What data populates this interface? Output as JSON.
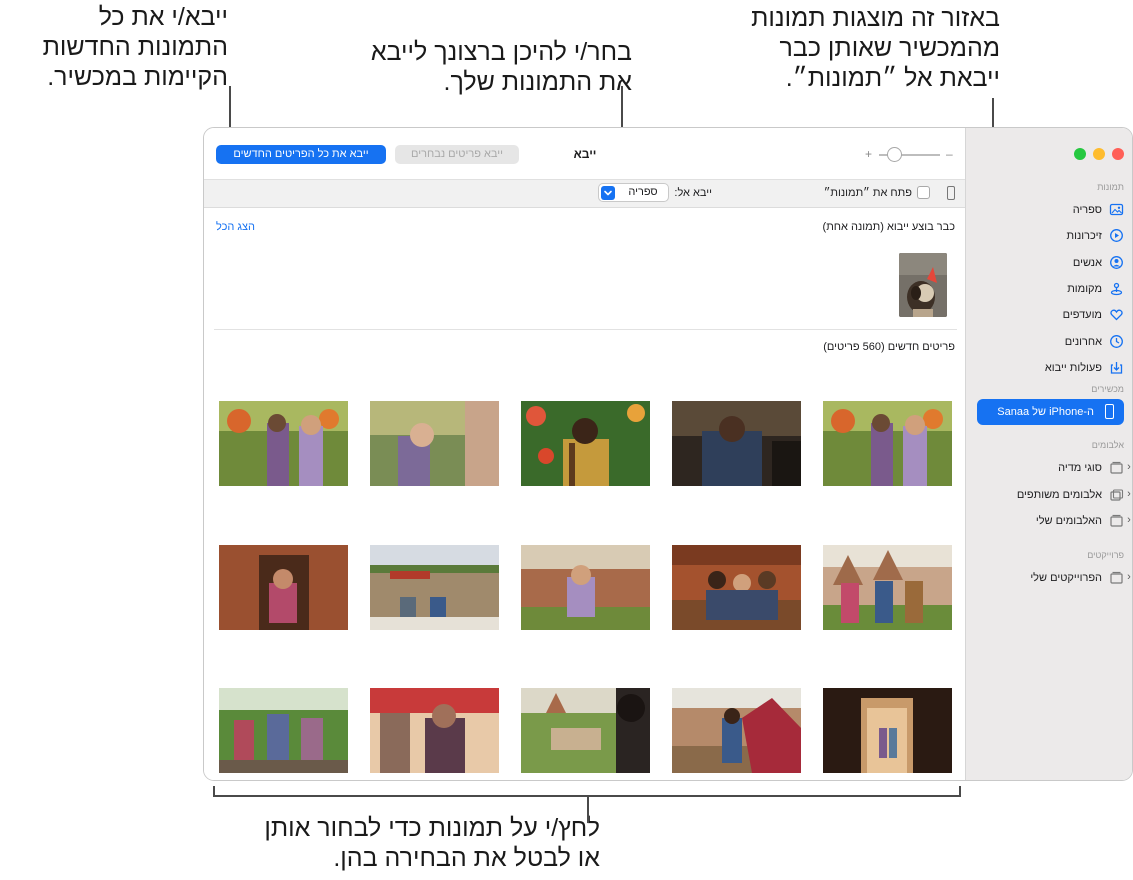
{
  "callouts": {
    "import_all": [
      "ייבא/י את כל",
      "התמונות החדשות",
      "הקיימות במכשיר."
    ],
    "choose_destination": [
      "בחר/י להיכן ברצונך לייבא",
      "את התמונות שלך."
    ],
    "already_imported": [
      "באזור זה מוצגות תמונות",
      "מהמכשיר שאותן כבר",
      "ייבאת אל ״תמונות״."
    ],
    "select_photos": [
      "לחץ/י על תמונות כדי לבחור אותן",
      "או לבטל את הבחירה בהן."
    ]
  },
  "toolbar": {
    "import_all_label": "ייבא את כל הפריטים החדשים",
    "import_selected_label": "ייבא פריטים נבחרים",
    "title": "ייבא",
    "zoom_minus": "–",
    "zoom_plus": "+"
  },
  "filterbar": {
    "open_photos_label": "פתח את ״תמונות״",
    "import_to_label": "ייבא אל:",
    "destination_value": "ספריה"
  },
  "already_imported": {
    "title": "כבר בוצע ייבוא (תמונה אחת)",
    "show_all": "הצג הכל"
  },
  "new_items": {
    "title": "פריטים חדשים (560 פריטים)"
  },
  "sidebar": {
    "section_photos": "תמונות",
    "items": [
      {
        "label": "ספריה",
        "icon": "library-icon"
      },
      {
        "label": "זיכרונות",
        "icon": "memories-icon"
      },
      {
        "label": "אנשים",
        "icon": "people-icon"
      },
      {
        "label": "מקומות",
        "icon": "places-icon"
      },
      {
        "label": "מועדפים",
        "icon": "favorites-icon"
      },
      {
        "label": "אחרונים",
        "icon": "recents-icon"
      },
      {
        "label": "פעולות ייבוא",
        "icon": "imports-icon"
      }
    ],
    "section_devices": "מכשירים",
    "device_label": "ה-iPhone של Sanaa",
    "section_albums": "אלבומים",
    "albums": [
      {
        "label": "סוגי מדיה"
      },
      {
        "label": "אלבומים משותפים"
      },
      {
        "label": "האלבומים שלי"
      }
    ],
    "section_projects": "פרוייקטים",
    "projects": [
      {
        "label": "הפרוייקטים שלי"
      }
    ]
  },
  "colors": {
    "accent": "#1672f2",
    "traffic_close": "#26c840",
    "traffic_min": "#febc2e",
    "traffic_max": "#ff5f57"
  }
}
